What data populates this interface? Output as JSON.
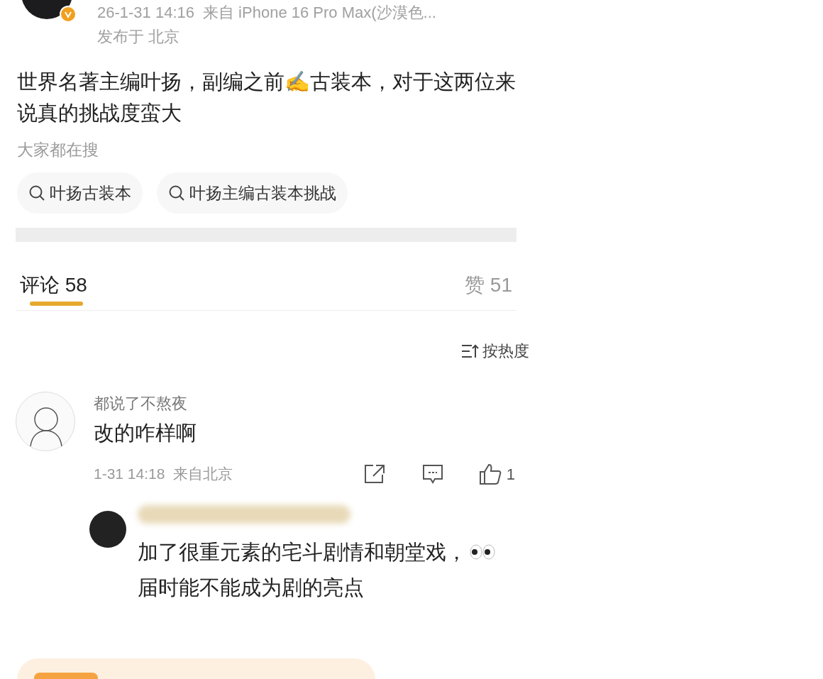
{
  "post": {
    "meta": "26-1-31 14:16",
    "source": "来自 iPhone 16 Pro Max(沙漠色...",
    "location": "发布于 北京",
    "verified": true,
    "text": "世界名著主编叶扬，副编之前✍古装本，对于这两位来说真的挑战度蛮大"
  },
  "searches": {
    "title": "大家都在搜",
    "items": [
      "叶扬古装本",
      "叶扬主编古装本挑战"
    ]
  },
  "tabs": [
    {
      "label": "评论 58",
      "selected": true
    },
    {
      "label": "赞 51",
      "selected": false
    }
  ],
  "sort": "按热度",
  "comments": [
    {
      "name": "都说了不熬夜",
      "text": "改的咋样啊",
      "time": "1-31 14:18",
      "source": "来自北京",
      "likes": "1",
      "reply": {
        "line_1": "加了很重元素的宅斗剧情和朝堂戏，",
        "line_2": "届时能不能成为剧的亮点"
      }
    }
  ]
}
